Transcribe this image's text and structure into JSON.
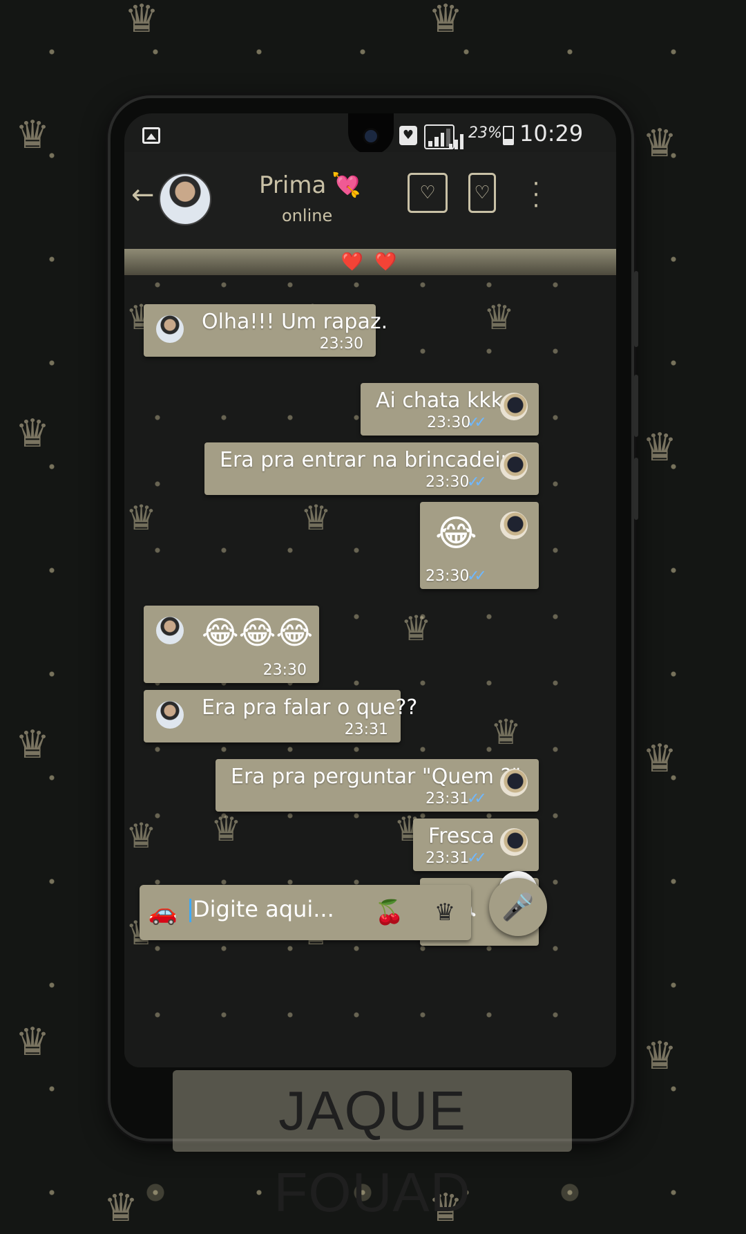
{
  "status_bar": {
    "battery": "23%",
    "time": "10:29",
    "icons": [
      "gallery-icon",
      "heart-notification-icon",
      "signal-icon",
      "battery-icon"
    ]
  },
  "header": {
    "contact_name": "Prima",
    "name_emoji": "💘",
    "status": "online",
    "icons": [
      "back-arrow-icon",
      "clapperboard-heart-icon",
      "phone-heart-icon",
      "more-vert-icon"
    ]
  },
  "banner": {
    "text": "❤️‍ ❤️"
  },
  "messages": [
    {
      "direction": "in",
      "text": "Olha!!! Um rapaz.",
      "time": "23:30"
    },
    {
      "direction": "out",
      "text": "Ai chata kkk",
      "time": "23:30",
      "read": true
    },
    {
      "direction": "out",
      "text": "Era pra entrar na brincadeira",
      "time": "23:30",
      "read": true
    },
    {
      "direction": "out",
      "text": "😂",
      "time": "23:30",
      "read": true
    },
    {
      "direction": "in",
      "text": "😂😂😂",
      "time": "23:30"
    },
    {
      "direction": "in",
      "text": "Era pra falar o que??",
      "time": "23:31"
    },
    {
      "direction": "out",
      "text": "Era pra perguntar \"Quem ?\"",
      "time": "23:31",
      "read": true
    },
    {
      "direction": "out",
      "text": "Fresca",
      "time": "23:31",
      "read": true
    },
    {
      "direction": "out",
      "text": "😂",
      "time": "",
      "read": false
    }
  ],
  "composer": {
    "placeholder": "Digite aqui...",
    "icons": [
      "car-icon",
      "cherry-icon",
      "crown-icon",
      "heart-mic-icon"
    ]
  },
  "watermark": "JAQUE FOUAD",
  "colors": {
    "bubble": "#a49e86",
    "accent": "#c9c1a6",
    "tick": "#6fb8ff"
  }
}
